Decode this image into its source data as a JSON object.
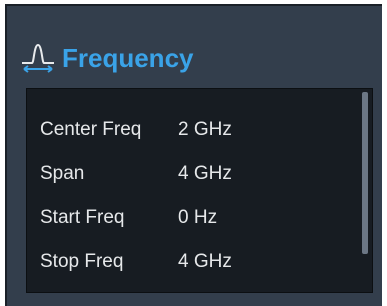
{
  "panel": {
    "title": "Frequency",
    "icon": "spectrum-peak-icon",
    "accent_color": "#3aa3e8"
  },
  "list": {
    "items": [
      {
        "label": "Center Freq",
        "value": "2 GHz"
      },
      {
        "label": "Span",
        "value": "4 GHz"
      },
      {
        "label": "Start Freq",
        "value": "0 Hz"
      },
      {
        "label": "Stop Freq",
        "value": "4 GHz"
      }
    ]
  }
}
